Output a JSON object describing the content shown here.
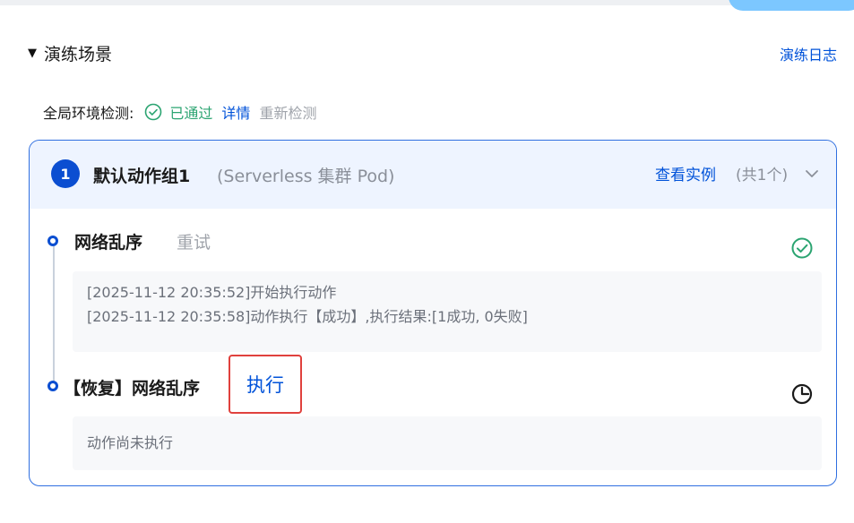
{
  "section": {
    "caret": "▼",
    "title": "演练场景",
    "log_link": "演练日志"
  },
  "env_check": {
    "label": "全局环境检测:",
    "status": "已通过",
    "detail": "详情",
    "recheck": "重新检测"
  },
  "group": {
    "index": "1",
    "name": "默认动作组1",
    "target": "(Serverless 集群 Pod)",
    "view_instances": "查看实例",
    "instance_count": "(共1个)"
  },
  "actions": [
    {
      "title": "网络乱序",
      "retry": "重试",
      "status_icon": "check-circle-icon",
      "logs": [
        "[2025-11-12 20:35:52]开始执行动作",
        "[2025-11-12 20:35:58]动作执行【成功】,执行结果:[1成功, 0失败]"
      ]
    },
    {
      "title": "【恢复】网络乱序",
      "execute": "执行",
      "status_icon": "clock-pie-icon",
      "logs": [
        "动作尚未执行"
      ]
    }
  ],
  "colors": {
    "primary": "#0052d9",
    "success": "#2ba471",
    "highlight_border": "#e0413d"
  }
}
